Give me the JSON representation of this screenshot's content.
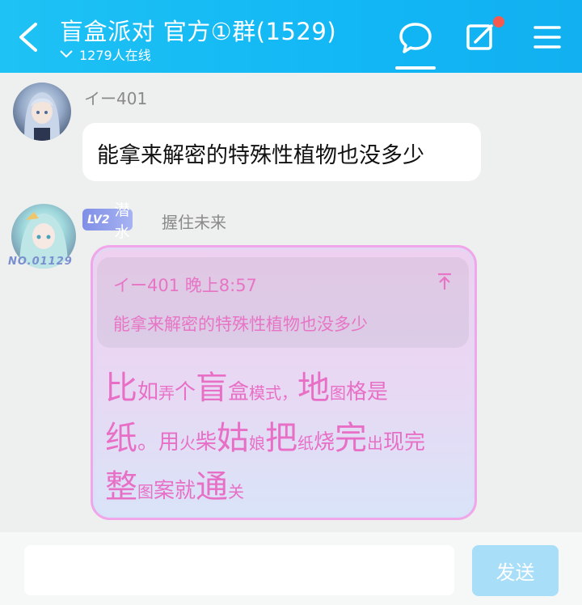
{
  "header": {
    "title": "盲盒派对 官方①群(1529)",
    "online": "1279人在线",
    "colors": {
      "bar": "#12b7f5",
      "notify_dot": "#f55a4e"
    }
  },
  "messages": [
    {
      "sender": "イー401",
      "text": "能拿来解密的特殊性植物也没多少"
    },
    {
      "level_tag": "LV2",
      "rank": "潜水",
      "sender": "握住未来",
      "avatar_badge": "NO.01129",
      "quote": {
        "meta": "イー401 晚上8:57",
        "text": "能拿来解密的特殊性植物也没多少"
      },
      "lines": [
        [
          "比",
          "如",
          "弄",
          "个",
          "盲",
          "盒",
          "模式，",
          "地",
          "图",
          "格是"
        ],
        [
          "纸",
          "。用",
          "火",
          "柴",
          "姑",
          "娘",
          "把",
          "纸",
          "烧",
          "完",
          "出",
          "现完"
        ],
        [
          "整",
          "图",
          "案就",
          "通",
          "关"
        ]
      ]
    }
  ],
  "composer": {
    "send_label": "发送",
    "accent": "#a9def8"
  }
}
